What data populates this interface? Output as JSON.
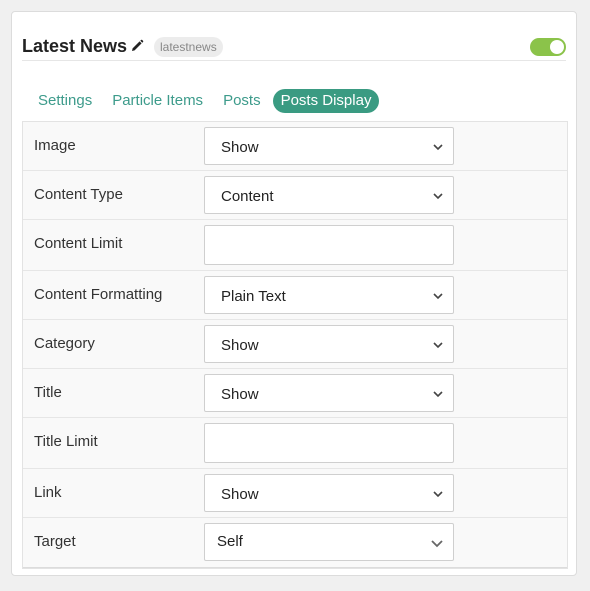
{
  "header": {
    "title": "Latest News",
    "badge": "latestnews",
    "toggle_on": true,
    "accent": "#8bc34a"
  },
  "tabs": [
    {
      "label": "Settings",
      "active": false
    },
    {
      "label": "Particle Items",
      "active": false
    },
    {
      "label": "Posts",
      "active": false
    },
    {
      "label": "Posts Display",
      "active": true
    }
  ],
  "form": {
    "rows": [
      {
        "label": "Image",
        "type": "select",
        "value": "Show"
      },
      {
        "label": "Content Type",
        "type": "select",
        "value": "Content"
      },
      {
        "label": "Content Limit",
        "type": "input",
        "value": ""
      },
      {
        "label": "Content Formatting",
        "type": "select",
        "value": "Plain Text"
      },
      {
        "label": "Category",
        "type": "select",
        "value": "Show"
      },
      {
        "label": "Title",
        "type": "select",
        "value": "Show"
      },
      {
        "label": "Title Limit",
        "type": "input",
        "value": ""
      },
      {
        "label": "Link",
        "type": "select",
        "value": "Show"
      },
      {
        "label": "Target",
        "type": "select",
        "value": "Self"
      }
    ]
  },
  "colors": {
    "tab_text": "#3d9b8b",
    "tab_active_bg": "#3a9b82"
  },
  "icons": {
    "edit": "pencil-icon",
    "dropdown": "chevron-down-icon"
  }
}
